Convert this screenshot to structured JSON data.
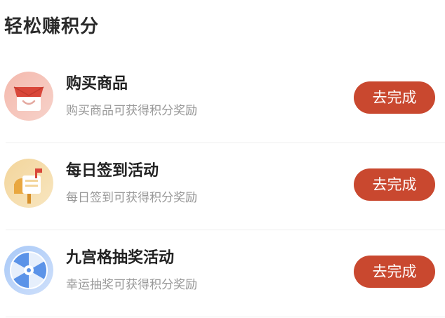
{
  "section": {
    "title": "轻松赚积分"
  },
  "tasks": [
    {
      "icon": "shopping-bag-icon",
      "title": "购买商品",
      "description": "购买商品可获得积分奖励",
      "button_label": "去完成"
    },
    {
      "icon": "mailbox-icon",
      "title": "每日签到活动",
      "description": "每日签到可获得积分奖励",
      "button_label": "去完成"
    },
    {
      "icon": "prize-wheel-icon",
      "title": "九宫格抽奖活动",
      "description": "幸运抽奖可获得积分奖励",
      "button_label": "去完成"
    }
  ],
  "colors": {
    "button": "#c9482f",
    "title_text": "#222222",
    "desc_text": "#999999",
    "divider": "#eeeeee"
  }
}
